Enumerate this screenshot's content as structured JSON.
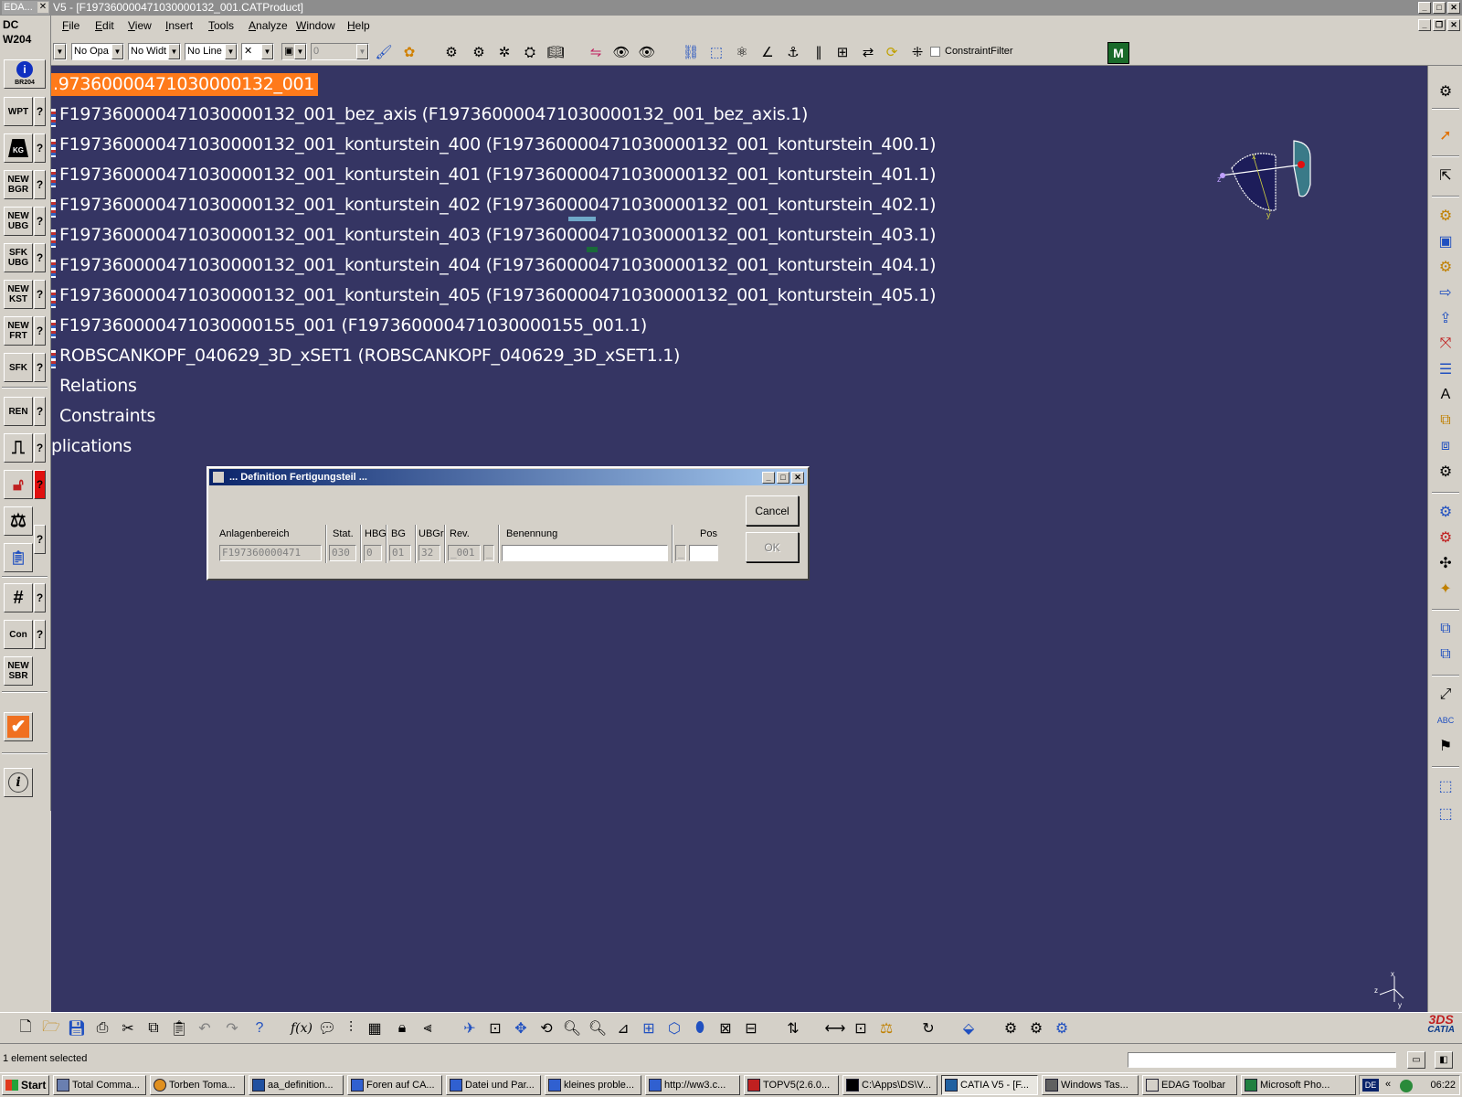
{
  "titlebar": {
    "eda_label": "EDA...",
    "close_x": "✕",
    "caption": "V5 - [F197360000471030000132_001.CATProduct]"
  },
  "menubar": {
    "items": [
      "File",
      "Edit",
      "View",
      "Insert",
      "Tools",
      "Analyze",
      "Window",
      "Help"
    ]
  },
  "leftpanel": {
    "dc_line1": "DC",
    "dc_line2": "W204",
    "info_sub": "BR204",
    "buttons": [
      "WPT",
      "KG",
      "NEW BGR",
      "NEW UBG",
      "SFK UBG",
      "NEW KST",
      "NEW FRT",
      "SFK",
      "REN",
      "Con",
      "NEW SBR"
    ],
    "help_glyph": "?",
    "info_glyph": "i"
  },
  "toolbar": {
    "combo_opacity": "No Opa",
    "combo_width": "No Widt",
    "combo_line": "No Line",
    "combo_layer": "0",
    "constraint_filter": "ConstraintFilter",
    "m_button": "M"
  },
  "tree": {
    "root": ".97360000471030000132_001",
    "items": [
      "F197360000471030000132_001_bez_axis (F197360000471030000132_001_bez_axis.1)",
      "F197360000471030000132_001_konturstein_400 (F197360000471030000132_001_konturstein_400.1)",
      "F197360000471030000132_001_konturstein_401 (F197360000471030000132_001_konturstein_401.1)",
      "F197360000471030000132_001_konturstein_402 (F197360000471030000132_001_konturstein_402.1)",
      "F197360000471030000132_001_konturstein_403 (F197360000471030000132_001_konturstein_403.1)",
      "F197360000471030000132_001_konturstein_404 (F197360000471030000132_001_konturstein_404.1)",
      "F197360000471030000132_001_konturstein_405 (F197360000471030000132_001_konturstein_405.1)",
      "F197360000471030000155_001 (F197360000471030000155_001.1)",
      "ROBSCANKOPF_040629_3D_xSET1 (ROBSCANKOPF_040629_3D_xSET1.1)",
      "Relations",
      "Constraints",
      "plications"
    ]
  },
  "dialog": {
    "title": "... Definition Fertigungsteil ...",
    "labels": {
      "anlagenbereich": "Anlagenbereich",
      "stat": "Stat.",
      "hbg": "HBG",
      "bg": "BG",
      "ubgr": "UBGr",
      "rev": "Rev.",
      "benennung": "Benennung",
      "pos": "Pos"
    },
    "values": {
      "anlagenbereich": "F197360000471",
      "stat": "030",
      "hbg": "0",
      "bg": "01",
      "ubgr": "32",
      "rev": "_001",
      "rev_suffix": "_",
      "benennung": "",
      "pos_prefix": "_",
      "pos": ""
    },
    "cancel_label": "Cancel",
    "ok_label": "OK"
  },
  "compass_axes": {
    "x": "x",
    "y": "y",
    "z": "z"
  },
  "status": {
    "text": "1 element selected"
  },
  "catia_logo": "CATIA",
  "taskbar": {
    "start": "Start",
    "tasks": [
      "Total Comma...",
      "Torben Toma...",
      "aa_definition...",
      "Foren auf CA...",
      "Datei und Par...",
      "kleines proble...",
      "http://ww3.c...",
      "TOPV5(2.6.0...",
      "C:\\Apps\\DS\\V...",
      "CATIA V5 - [F...",
      "Windows Tas...",
      "EDAG Toolbar",
      "Microsoft Pho..."
    ],
    "lang": "DE",
    "chevron": "«",
    "clock": "06:22"
  },
  "colors": {
    "viewport_bg": "#353563",
    "selection": "#ff7a1a",
    "dialog_title": "#0a246a"
  }
}
